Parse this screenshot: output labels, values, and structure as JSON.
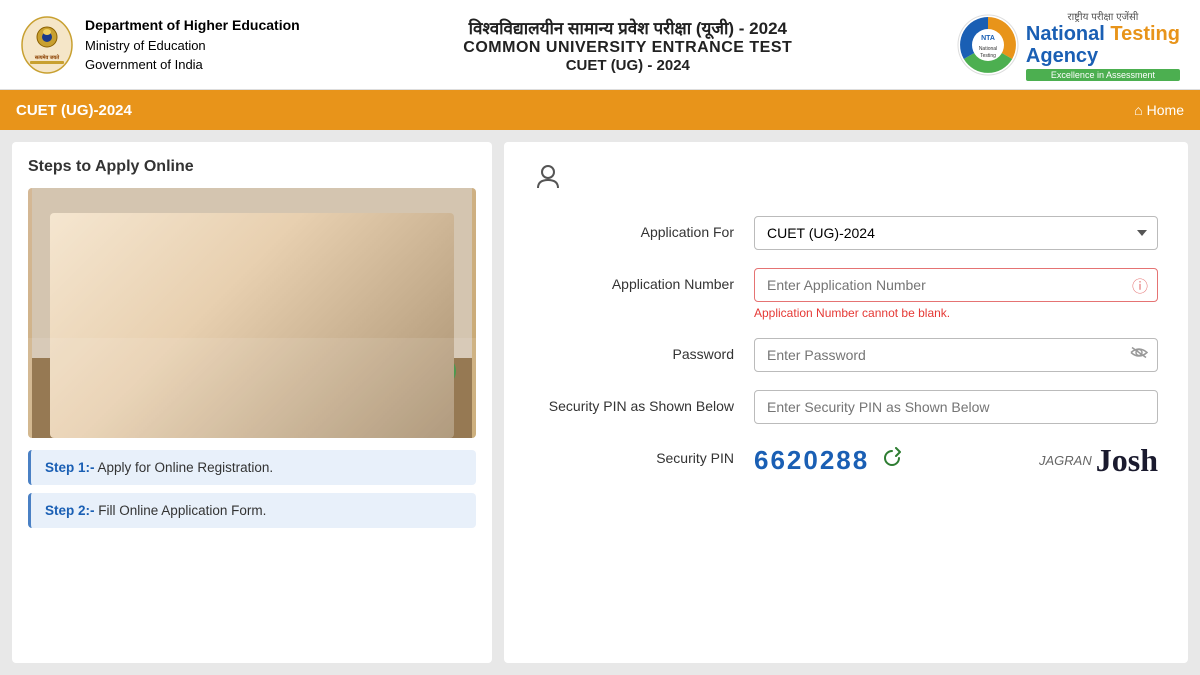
{
  "header": {
    "dept_name": "Department of Higher Education",
    "ministry": "Ministry of Education",
    "govt": "Government of India",
    "hindi_title": "विश्वविद्यालयीन सामान्य प्रवेश परीक्षा (यूजी) - 2024",
    "english_title": "COMMON UNIVERSITY ENTRANCE TEST",
    "cuet_title": "CUET (UG) - 2024",
    "nta_top": "राष्ट्रीय परीक्षा एजेंसी",
    "nta_name": "National Testing Agency",
    "nta_tagline": "Excellence in Assessment"
  },
  "navbar": {
    "title": "CUET (UG)-2024",
    "home_label": "Home"
  },
  "left_panel": {
    "title": "Steps to Apply Online",
    "step1_label": "Step 1:-",
    "step1_text": " Apply for Online Registration.",
    "step2_label": "Step 2:-",
    "step2_text": " Fill Online Application Form."
  },
  "form": {
    "application_for_label": "Application For",
    "application_for_value": "CUET (UG)-2024",
    "application_number_label": "Application Number",
    "application_number_placeholder": "Enter Application Number",
    "application_number_error": "Application Number cannot be blank.",
    "password_label": "Password",
    "password_placeholder": "Enter Password",
    "security_pin_label_above": "Security PIN as Shown Below",
    "security_pin_placeholder": "Enter Security PIN as Shown Below",
    "security_pin_label": "Security PIN",
    "security_pin_value": "6620288"
  },
  "icons": {
    "user": "○",
    "home": "⌂",
    "chevron_down": "▾",
    "error_circle": "ⓘ",
    "eye_off": "👁",
    "refresh": "↺"
  }
}
